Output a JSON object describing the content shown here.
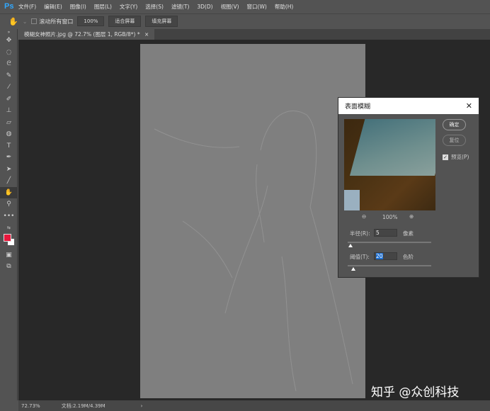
{
  "app": {
    "logo": "Ps"
  },
  "menu": [
    "文件(F)",
    "编辑(E)",
    "图像(I)",
    "图层(L)",
    "文字(Y)",
    "选择(S)",
    "滤镜(T)",
    "3D(D)",
    "视图(V)",
    "窗口(W)",
    "帮助(H)"
  ],
  "options": {
    "scroll_all": "滚动所有窗口",
    "zoom": "100%",
    "fit_screen": "适合屏幕",
    "fill_screen": "填充屏幕"
  },
  "tab": {
    "title": "模糊女神照片.jpg @ 72.7% (图层 1, RGB/8*) *",
    "close": "×"
  },
  "status": {
    "zoom": "72.73%",
    "doc": "文档:2.19M/4.39M",
    "arrow": "›"
  },
  "dialog": {
    "title": "表面模糊",
    "close": "✕",
    "ok": "确定",
    "reset": "复位",
    "preview_label": "预览(P)",
    "preview_checked": true,
    "zoom": "100%",
    "radius_label": "半径(R):",
    "radius_value": "5",
    "radius_unit": "像素",
    "threshold_label": "阈值(T):",
    "threshold_value": "20",
    "threshold_unit": "色阶"
  },
  "watermark": "知乎 @众创科技",
  "colors": {
    "foreground": "#e8173c",
    "background": "#ffffff"
  }
}
